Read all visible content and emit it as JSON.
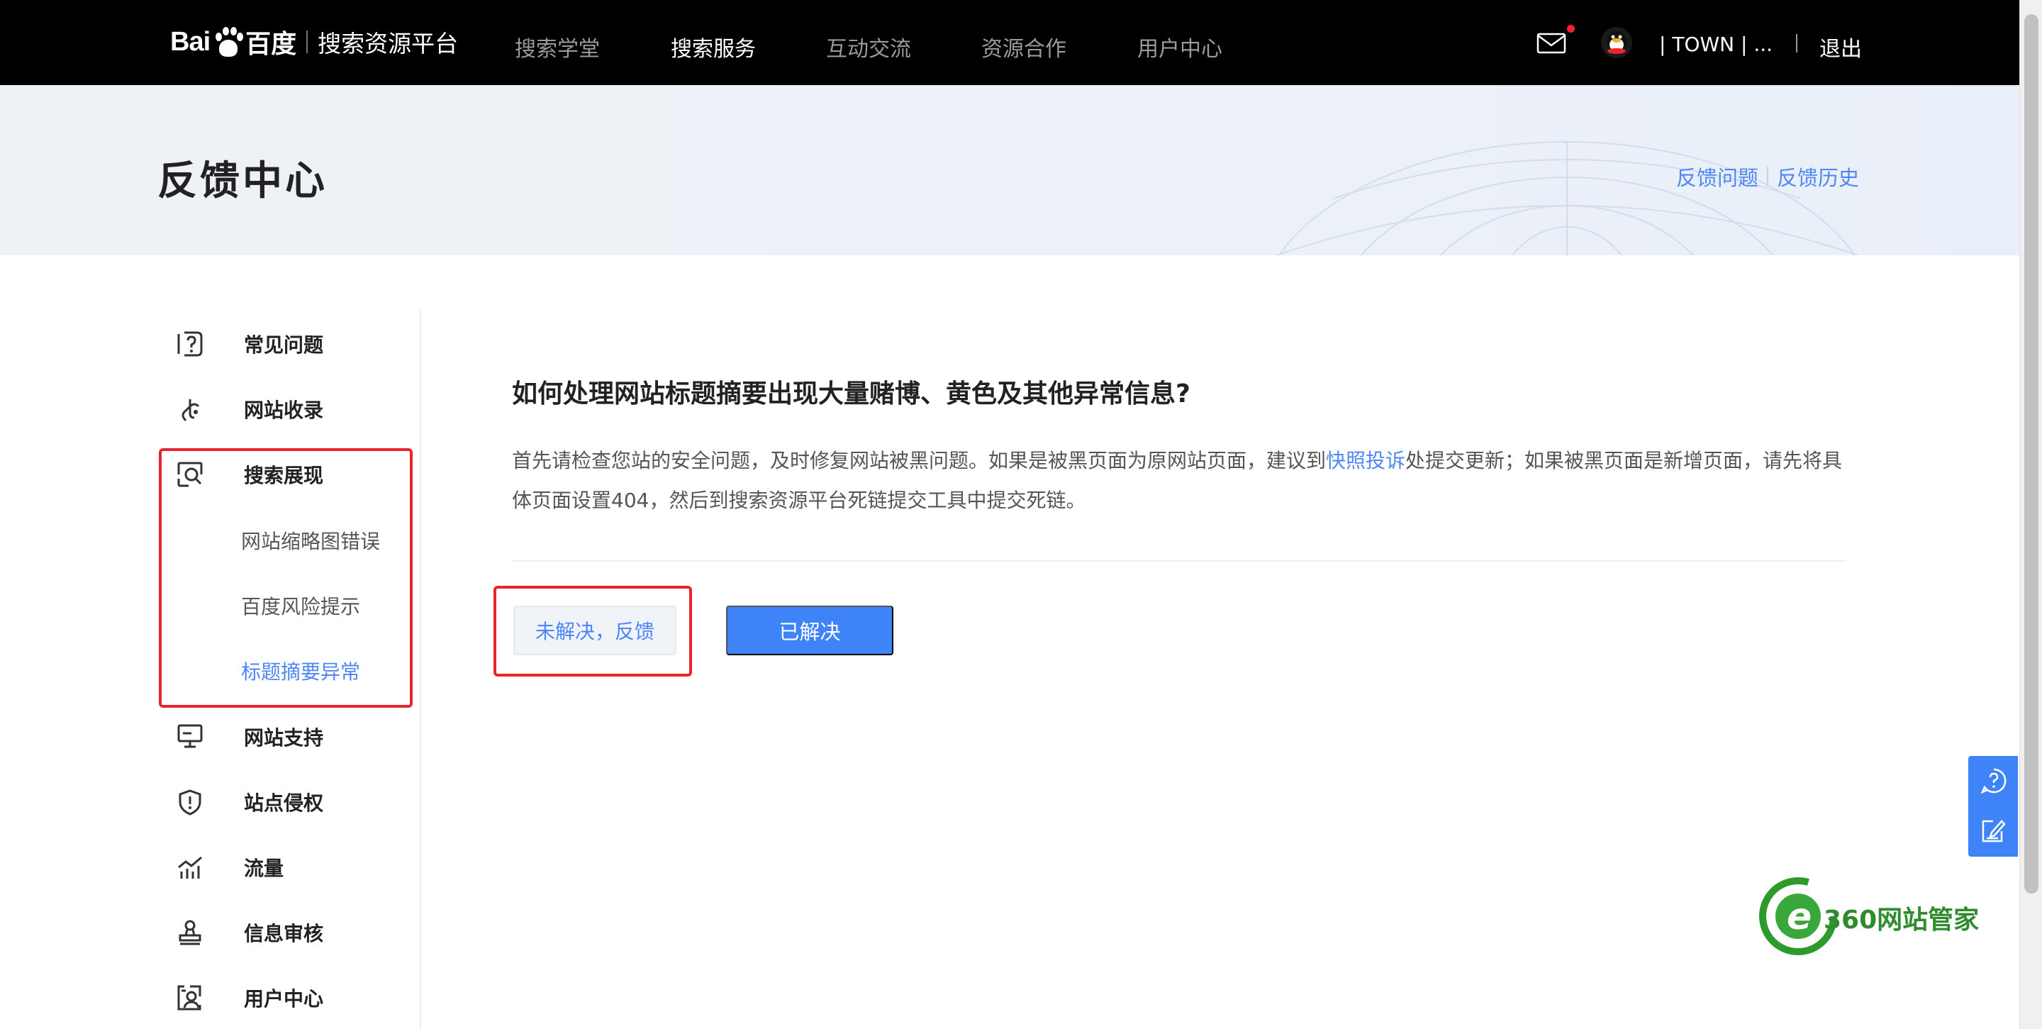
{
  "nav": {
    "logo_bai": "Bai",
    "logo_du": "du",
    "logo_baidu_cn": "百度",
    "platform": "搜索资源平台",
    "items": [
      {
        "label": "搜索学堂",
        "active": false
      },
      {
        "label": "搜索服务",
        "active": true
      },
      {
        "label": "互动交流",
        "active": false
      },
      {
        "label": "资源合作",
        "active": false
      },
      {
        "label": "用户中心",
        "active": false
      }
    ],
    "username": "| TOWN | ...",
    "logout": "退出",
    "icons": {
      "mail": "mail-icon",
      "avatar": "avatar"
    }
  },
  "banner": {
    "title": "反馈中心",
    "link_feedback": "反馈问题",
    "link_history": "反馈历史"
  },
  "sidebar": {
    "items": [
      {
        "label": "常见问题",
        "icon": "question-icon"
      },
      {
        "label": "网站收录",
        "icon": "index-icon"
      },
      {
        "label": "搜索展现",
        "icon": "search-display-icon"
      },
      {
        "label": "网站支持",
        "icon": "monitor-icon"
      },
      {
        "label": "站点侵权",
        "icon": "shield-icon"
      },
      {
        "label": "流量",
        "icon": "traffic-icon"
      },
      {
        "label": "信息审核",
        "icon": "stamp-icon"
      },
      {
        "label": "用户中心",
        "icon": "user-center-icon"
      }
    ],
    "subitems": [
      {
        "label": "网站缩略图错误",
        "active": false
      },
      {
        "label": "百度风险提示",
        "active": false
      },
      {
        "label": "标题摘要异常",
        "active": true
      }
    ]
  },
  "main": {
    "question": "如何处理网站标题摘要出现大量赌博、黄色及其他异常信息?",
    "answer_part1": "首先请检查您站的安全问题，及时修复网站被黑问题。如果是被黑页面为原网站页面，建议到",
    "answer_link": "快照投诉",
    "answer_part2": "处提交更新；如果被黑页面是新增页面，请先将具体页面设置404，然后到搜索资源平台死链提交工具中提交死链。",
    "btn_unsolved": "未解决，反馈",
    "btn_solved": "已解决"
  },
  "watermark": {
    "text": "360网站管家"
  },
  "colors": {
    "accent": "#3f83f8",
    "link": "#4e86f7",
    "highlight_box": "#e8242c",
    "nav_bg": "#000000"
  }
}
